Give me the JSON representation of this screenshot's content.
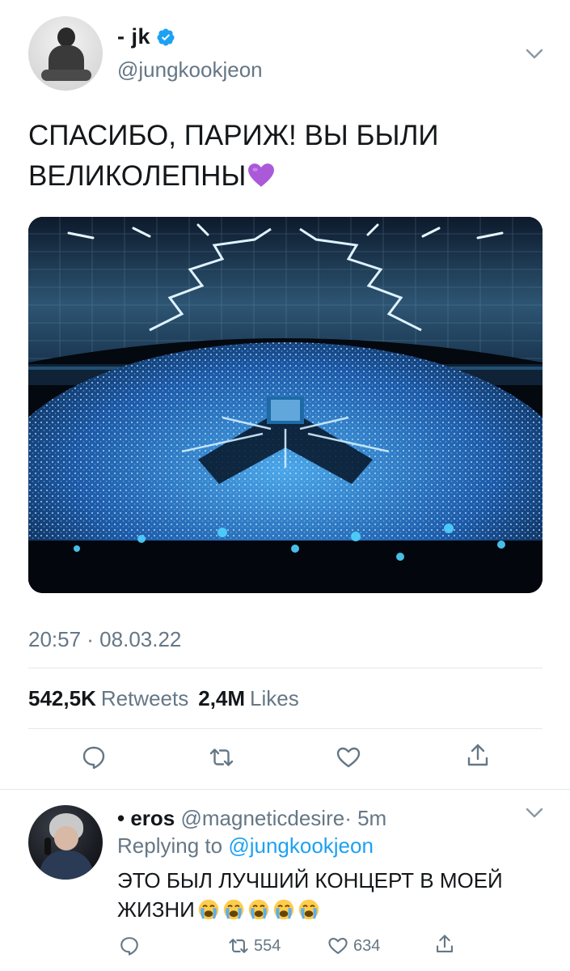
{
  "tweet": {
    "display_name": "- jk",
    "handle": "@jungkookjeon",
    "text_line1": "СПАСИБО, ПАРИЖ! ВЫ БЫЛИ",
    "text_line2": "ВЕЛИКОЛЕПНЫ",
    "emoji": "purple-heart",
    "timestamp": "20:57 · 08.03.22",
    "retweets_count": "542,5K",
    "retweets_label": "Retweets",
    "likes_count": "2,4M",
    "likes_label": "Likes",
    "media_description": "concert-stadium-photo"
  },
  "reply": {
    "prefix": "•",
    "display_name": "eros",
    "handle": "@magneticdesire",
    "time": "· 5m",
    "replying_label": "Replying to",
    "replying_to": "@jungkookjeon",
    "text_line1": "ЭТО БЫЛ ЛУЧШИЙ КОНЦЕРТ В МОЕЙ",
    "text_line2": "ЖИЗНИ",
    "retweet_count": "554",
    "like_count": "634"
  },
  "colors": {
    "accent": "#1da1f2",
    "secondary_text": "#657786",
    "primary_text": "#14171a",
    "divider": "#e1e8ed"
  },
  "icons": [
    "verified-icon",
    "caret-down-icon",
    "reply-icon",
    "retweet-icon",
    "like-icon",
    "share-icon",
    "purple-heart-emoji",
    "loudly-crying-emoji"
  ]
}
